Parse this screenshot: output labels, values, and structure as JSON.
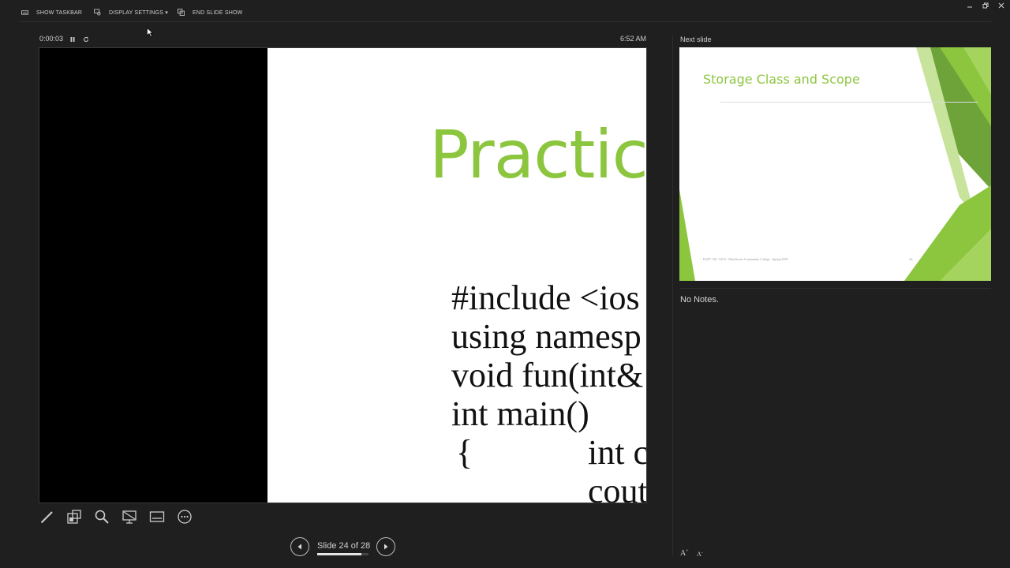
{
  "toolbar": {
    "show_taskbar": "SHOW TASKBAR",
    "display_settings": "DISPLAY SETTINGS ▾",
    "end_slide_show": "END SLIDE SHOW"
  },
  "timer": {
    "elapsed": "0:00:03",
    "clock": "6:52 AM"
  },
  "current_slide": {
    "title": "Practic",
    "code_lines": [
      "#include <ios",
      "using namesp",
      "void fun(int&",
      "int main()",
      "{",
      "int c",
      "cout"
    ]
  },
  "navigation": {
    "counter": "Slide 24 of 28",
    "progress_fraction": 0.857
  },
  "next_slide": {
    "label": "Next slide",
    "title": "Storage Class and Scope",
    "footer": "EGR* 130 - ES13 - Manchester Community College - Spring 2019",
    "number": "25"
  },
  "notes": {
    "text": "No Notes."
  },
  "font_controls": {
    "increase": "A",
    "decrease": "A"
  },
  "colors": {
    "accent_green": "#8cc63f",
    "background": "#1f1f1f"
  },
  "icons": [
    "taskbar-icon",
    "display-settings-icon",
    "end-show-icon",
    "pause-icon",
    "restart-icon",
    "pen-icon",
    "see-all-slides-icon",
    "zoom-icon",
    "black-screen-icon",
    "subtitles-icon",
    "more-options-icon",
    "previous-icon",
    "next-icon",
    "minimize-icon",
    "restore-icon",
    "close-icon"
  ]
}
